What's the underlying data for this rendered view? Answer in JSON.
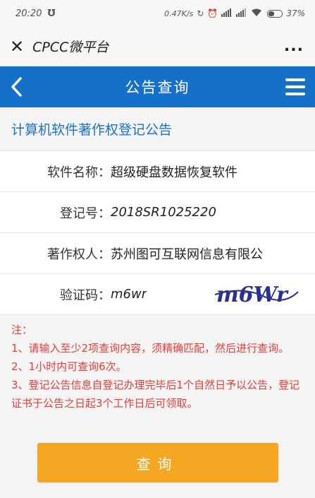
{
  "status_bar": {
    "time": "20:20",
    "network_speed": "0.47K/s",
    "battery_percent": "37%",
    "icons": [
      "notification-icon",
      "sync-icon",
      "alarm-icon",
      "hd-signal-icon",
      "signal-icon",
      "wifi-icon",
      "battery-icon"
    ]
  },
  "wechat_bar": {
    "title": "CPCC微平台",
    "more": "..."
  },
  "header": {
    "title": "公告查询"
  },
  "notice_heading": "计算机软件著作权登记公告",
  "form": {
    "software_name_label": "软件名称：",
    "software_name_value": "超级硬盘数据恢复软件",
    "reg_no_label": "登记号：",
    "reg_no_value": "2018SR1025220",
    "owner_label": "著作权人：",
    "owner_value": "苏州图可互联网信息有限公",
    "captcha_label": "验证码：",
    "captcha_value": "m6wr",
    "captcha_image_text": "m6Wr"
  },
  "notes": {
    "title": "注：",
    "line1": "1、请输入至少2项查询内容，须精确匹配，然后进行查询。",
    "line2": "2、1小时内可查询6次。",
    "line3": "3、登记公告信息自登记办理完毕后1个自然日予以公告，登记证书于公告之日起3个工作日后可领取。"
  },
  "submit_button": "查询",
  "colors": {
    "header_blue": "#1470c8",
    "heading_text_blue": "#1c72c9",
    "notes_red": "#e63b3b",
    "button_orange": "#f5a623"
  }
}
